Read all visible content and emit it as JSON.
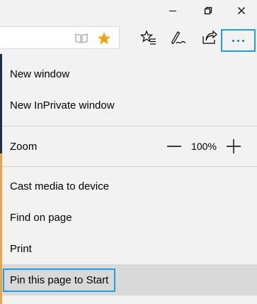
{
  "titlebar": {
    "buttons": [
      {
        "name": "minimize",
        "icon": "minimize-icon"
      },
      {
        "name": "restore",
        "icon": "restore-icon"
      },
      {
        "name": "close",
        "icon": "close-icon"
      }
    ]
  },
  "toolbar": {
    "address_icons": [
      "reading-view-icon",
      "favorite-star-icon"
    ],
    "icons": [
      "hub-icon",
      "web-note-icon",
      "share-icon"
    ],
    "more_icon": "more-actions-icon"
  },
  "menu": {
    "new_window": "New window",
    "new_inprivate": "New InPrivate window",
    "zoom_label": "Zoom",
    "zoom_value": "100%",
    "cast": "Cast media to device",
    "find": "Find on page",
    "print": "Print",
    "pin": "Pin this page to Start"
  },
  "colors": {
    "highlight_border": "#1ba1e2",
    "star": "#f0a30a",
    "hover_bg": "#d9d9d9"
  }
}
